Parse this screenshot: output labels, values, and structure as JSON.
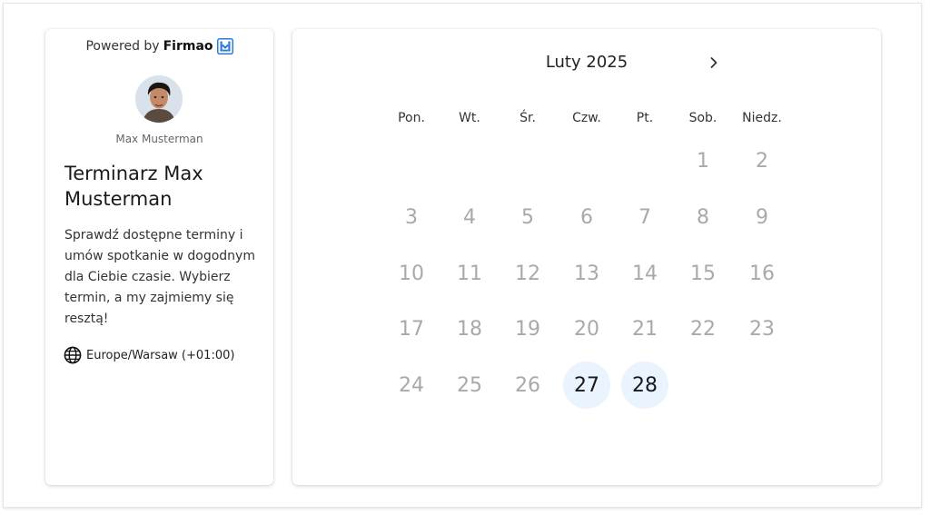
{
  "sidebar": {
    "powered_by": "Powered by",
    "brand": "Firmao",
    "avatar_name": "Max Musterman",
    "title": "Terminarz Max Musterman",
    "description": "Sprawdź dostępne terminy i umów spotkanie w dogodnym dla Ciebie czasie. Wybierz termin, a my zajmiemy się resztą!",
    "timezone": "Europe/Warsaw (+01:00)"
  },
  "calendar": {
    "month_label": "Luty 2025",
    "weekdays": [
      "Pon.",
      "Wt.",
      "Śr.",
      "Czw.",
      "Pt.",
      "Sob.",
      "Niedz."
    ],
    "weeks": [
      [
        "",
        "",
        "",
        "",
        "",
        "1",
        "2"
      ],
      [
        "3",
        "4",
        "5",
        "6",
        "7",
        "8",
        "9"
      ],
      [
        "10",
        "11",
        "12",
        "13",
        "14",
        "15",
        "16"
      ],
      [
        "17",
        "18",
        "19",
        "20",
        "21",
        "22",
        "23"
      ],
      [
        "24",
        "25",
        "26",
        "27",
        "28",
        "",
        ""
      ]
    ],
    "available_days": [
      "27",
      "28"
    ],
    "available_color": "#eaf4ff"
  },
  "icons": {
    "brand": "firmao-logo-icon",
    "timezone": "globe-icon",
    "next": "chevron-right-icon"
  }
}
